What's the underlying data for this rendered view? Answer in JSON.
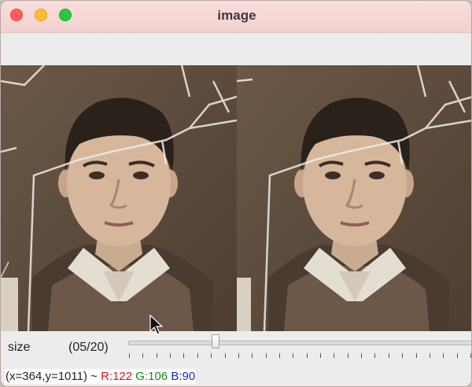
{
  "window": {
    "title": "image"
  },
  "slider": {
    "label": "size",
    "count": "(05/20)",
    "value": 5,
    "max": 20
  },
  "status": {
    "coords": "(x=364,y=1011) ~",
    "r": "R:122",
    "g": "G:106",
    "b": "B:90"
  },
  "colors": {
    "r": "#d6161b",
    "g": "#128a12",
    "b": "#1b27c4",
    "close": "#fe5f57",
    "minimize": "#febc2e",
    "maximize": "#28c840"
  },
  "icons": {
    "close": "close-icon",
    "minimize": "minimize-icon",
    "maximize": "maximize-icon",
    "cursor": "mouse-pointer-icon"
  }
}
